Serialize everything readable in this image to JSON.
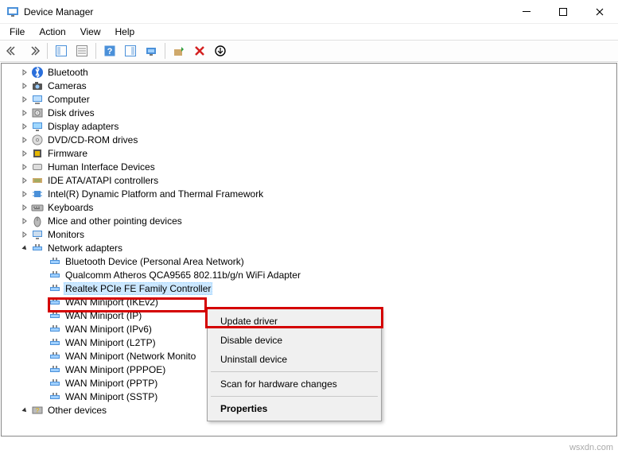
{
  "window": {
    "title": "Device Manager"
  },
  "menus": {
    "file": "File",
    "action": "Action",
    "view": "View",
    "help": "Help"
  },
  "tree": {
    "items": [
      {
        "label": "Bluetooth",
        "icon": "bluetooth",
        "expandable": true
      },
      {
        "label": "Cameras",
        "icon": "camera",
        "expandable": true
      },
      {
        "label": "Computer",
        "icon": "computer",
        "expandable": true
      },
      {
        "label": "Disk drives",
        "icon": "disk",
        "expandable": true
      },
      {
        "label": "Display adapters",
        "icon": "display",
        "expandable": true
      },
      {
        "label": "DVD/CD-ROM drives",
        "icon": "disc",
        "expandable": true
      },
      {
        "label": "Firmware",
        "icon": "firmware",
        "expandable": true
      },
      {
        "label": "Human Interface Devices",
        "icon": "hid",
        "expandable": true
      },
      {
        "label": "IDE ATA/ATAPI controllers",
        "icon": "ide",
        "expandable": true
      },
      {
        "label": "Intel(R) Dynamic Platform and Thermal Framework",
        "icon": "chip",
        "expandable": true
      },
      {
        "label": "Keyboards",
        "icon": "keyboard",
        "expandable": true
      },
      {
        "label": "Mice and other pointing devices",
        "icon": "mouse",
        "expandable": true
      },
      {
        "label": "Monitors",
        "icon": "monitor",
        "expandable": true
      }
    ],
    "network": {
      "label": "Network adapters",
      "children": [
        "Bluetooth Device (Personal Area Network)",
        "Qualcomm Atheros QCA9565 802.11b/g/n WiFi Adapter",
        "Realtek PCIe FE Family Controller",
        "WAN Miniport (IKEv2)",
        "WAN Miniport (IP)",
        "WAN Miniport (IPv6)",
        "WAN Miniport (L2TP)",
        "WAN Miniport (Network Monito",
        "WAN Miniport (PPPOE)",
        "WAN Miniport (PPTP)",
        "WAN Miniport (SSTP)"
      ]
    },
    "last": {
      "label": "Other devices"
    }
  },
  "context_menu": {
    "update": "Update driver",
    "disable": "Disable device",
    "uninstall": "Uninstall device",
    "scan": "Scan for hardware changes",
    "properties": "Properties"
  },
  "watermark": "wsxdn.com"
}
